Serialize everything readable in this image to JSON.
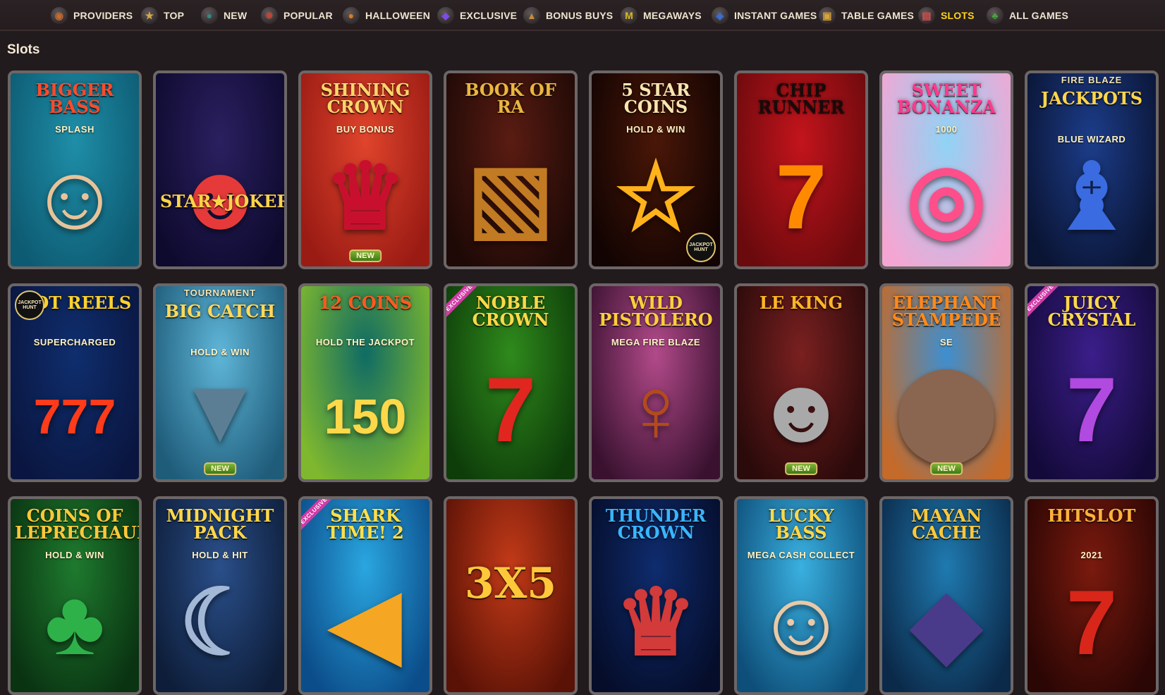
{
  "nav": {
    "categories": [
      {
        "label": "PROVIDERS",
        "icon": "providers-icon",
        "glyph": "◉",
        "color": "#c46a2e",
        "active": false
      },
      {
        "label": "TOP",
        "icon": "star-icon",
        "glyph": "★",
        "color": "#d7a64a",
        "active": false
      },
      {
        "label": "NEW",
        "icon": "globe-icon",
        "glyph": "●",
        "color": "#2f8a86",
        "active": false
      },
      {
        "label": "POPULAR",
        "icon": "rocket-icon",
        "glyph": "✹",
        "color": "#b9483a",
        "active": false
      },
      {
        "label": "HALLOWEEN",
        "icon": "pumpkin-icon",
        "glyph": "●",
        "color": "#e07a1c",
        "active": false
      },
      {
        "label": "EXCLUSIVE",
        "icon": "gem-icon",
        "glyph": "◆",
        "color": "#7d4de0",
        "active": false
      },
      {
        "label": "BONUS BUYS",
        "icon": "money-bag-icon",
        "glyph": "▲",
        "color": "#c88a3c",
        "active": false
      },
      {
        "label": "MEGAWAYS",
        "icon": "megaways-coin-icon",
        "glyph": "M",
        "color": "#d8b81f",
        "active": false
      },
      {
        "label": "INSTANT GAMES",
        "icon": "joystick-icon",
        "glyph": "◈",
        "color": "#3a6fd8",
        "active": false
      },
      {
        "label": "TABLE GAMES",
        "icon": "dice-icon",
        "glyph": "▣",
        "color": "#d9a339",
        "active": false
      },
      {
        "label": "SLOTS",
        "icon": "slot-machine-icon",
        "glyph": "▤",
        "color": "#d94c4c",
        "active": true
      },
      {
        "label": "ALL GAMES",
        "icon": "clover-icon",
        "glyph": "♣",
        "color": "#46a43b",
        "active": false
      }
    ]
  },
  "section": {
    "title": "Slots"
  },
  "games": [
    {
      "title": "BIGGER BASS",
      "subtitle": "SPLASH",
      "bg1": "#1f8ea8",
      "bg2": "#0d5b72",
      "color": "#ff4b2b",
      "art": "☺",
      "artColor": "#e7c39a"
    },
    {
      "title": "STAR★JOKER",
      "subtitle": "",
      "bg1": "#2a2060",
      "bg2": "#0e0a2e",
      "color": "#ffd44a",
      "art": "☻",
      "artColor": "#e63a3a",
      "titleTop": 170
    },
    {
      "title": "SHINING CROWN",
      "subtitle": "BUY BONUS",
      "bg1": "#e0442c",
      "bg2": "#9a1b14",
      "color": "#ffd66b",
      "art": "♛",
      "artColor": "#c8102e",
      "new": true
    },
    {
      "title": "BOOK OF RA",
      "subtitle": "",
      "bg1": "#5a1c12",
      "bg2": "#1e0906",
      "color": "#e9b640",
      "art": "▧",
      "artColor": "#c27b22"
    },
    {
      "title": "5 STAR COINS",
      "subtitle": "HOLD & WIN",
      "bg1": "#4a1708",
      "bg2": "#120402",
      "color": "#f7e6b0",
      "art": "☆",
      "artColor": "#ffb21a",
      "jackpot": true,
      "jackpotPos": "br"
    },
    {
      "title": "Chip Runner",
      "subtitle": "",
      "bg1": "#c4141c",
      "bg2": "#6a0a0d",
      "color": "#1a0a0a",
      "art": "7",
      "artColor": "#ff8a00"
    },
    {
      "title": "SWEET BONANZA",
      "subtitle": "1000",
      "bg1": "#8fd3f5",
      "bg2": "#f4a6d3",
      "color": "#ff3a8c",
      "art": "◎",
      "artColor": "#ff4f8b"
    },
    {
      "title": "JACKPOTS",
      "subtitle": "BLUE WIZARD",
      "bg1": "#1c3d8a",
      "bg2": "#0a1433",
      "color": "#ffd54a",
      "art": "♝",
      "artColor": "#3a6be0",
      "topText": "FIRE BLAZE"
    },
    {
      "title": "HOT REELS",
      "subtitle": "SUPERCHARGED",
      "bg1": "#0f2e6e",
      "bg2": "#0a1640",
      "color": "#ffd22e",
      "art": "777",
      "artColor": "#ff3b1a",
      "jackpot": true,
      "jackpotPos": "tl"
    },
    {
      "title": "BIG CATCH",
      "subtitle": "HOLD & WIN",
      "bg1": "#5fb6d8",
      "bg2": "#1f5c7a",
      "color": "#ffd95a",
      "art": "▼",
      "artColor": "#5c7e94",
      "topText": "TOURNAMENT",
      "new": true
    },
    {
      "title": "12 COINS",
      "subtitle": "HOLD THE JACKPOT",
      "bg1": "#0f6b64",
      "bg2": "#7fb82e",
      "color": "#ff5a1f",
      "art": "150",
      "artColor": "#ffd84a"
    },
    {
      "title": "NOBLE CROWN",
      "subtitle": "",
      "bg1": "#2f8a1c",
      "bg2": "#0e3d0a",
      "color": "#ffd84a",
      "art": "7",
      "artColor": "#e0261f",
      "exclusive": true
    },
    {
      "title": "WILD PISTOLERO",
      "subtitle": "MEGA FIRE BLAZE",
      "bg1": "#b24a8a",
      "bg2": "#3a1230",
      "color": "#ffcf3a",
      "art": "♀",
      "artColor": "#b34a1e"
    },
    {
      "title": "LE KING",
      "subtitle": "",
      "bg1": "#7a2020",
      "bg2": "#2a0a0a",
      "color": "#ffb626",
      "art": "☻",
      "artColor": "#a9a9a9",
      "new": true
    },
    {
      "title": "ELEPHANT STAMPEDE",
      "subtitle": "SE",
      "bg1": "#3d8fd0",
      "bg2": "#c46a2a",
      "color": "#ff8a1a",
      "art": "⬤",
      "artColor": "#8a6550",
      "new": true
    },
    {
      "title": "JUICY CRYSTAL",
      "subtitle": "",
      "bg1": "#3b1e8a",
      "bg2": "#140a3a",
      "color": "#ffd84a",
      "art": "7",
      "artColor": "#b04ae0",
      "exclusive": true
    },
    {
      "title": "COINS of Leprechaun",
      "subtitle": "HOLD & WIN",
      "bg1": "#1e7a2e",
      "bg2": "#0a3312",
      "color": "#ffc83a",
      "art": "♣",
      "artColor": "#2fb14a"
    },
    {
      "title": "MIDNIGHT PACK",
      "subtitle": "HOLD & HIT",
      "bg1": "#2a4f8a",
      "bg2": "#0e1e3a",
      "color": "#ffd84a",
      "art": "☾",
      "artColor": "#a3b7d6"
    },
    {
      "title": "SHARK TIME! 2",
      "subtitle": "",
      "bg1": "#2aa6e0",
      "bg2": "#0b4d8a",
      "color": "#ffe04a",
      "art": "◀",
      "artColor": "#f5a623",
      "exclusive": true
    },
    {
      "title": "3X5",
      "subtitle": "",
      "bg1": "#c33a18",
      "bg2": "#5a1206",
      "color": "#ffc83a",
      "art": "",
      "artColor": "#ffc83a",
      "titleTop": 90,
      "titleSize": 60
    },
    {
      "title": "THUNDER CROWN",
      "subtitle": "",
      "bg1": "#0f2c6e",
      "bg2": "#050d2a",
      "color": "#3ab5ff",
      "art": "♛",
      "artColor": "#d33a3a"
    },
    {
      "title": "LUCKY BASS",
      "subtitle": "MEGA CASH COLLECT",
      "bg1": "#3ab0e0",
      "bg2": "#0e4f7a",
      "color": "#ffd84a",
      "art": "☺",
      "artColor": "#e8c9a8"
    },
    {
      "title": "MAYAN CACHE",
      "subtitle": "",
      "bg1": "#1f7ab0",
      "bg2": "#0b2a4a",
      "color": "#ffc83a",
      "art": "◆",
      "artColor": "#4a3a8a"
    },
    {
      "title": "HITSLOT",
      "subtitle": "2021",
      "bg1": "#7a1a0e",
      "bg2": "#2a0604",
      "color": "#ffb23a",
      "art": "7",
      "artColor": "#d8261a"
    }
  ],
  "labels": {
    "new": "NEW",
    "exclusive": "EXCLUSIVE",
    "jackpot": "JACKPOT HUNT"
  }
}
